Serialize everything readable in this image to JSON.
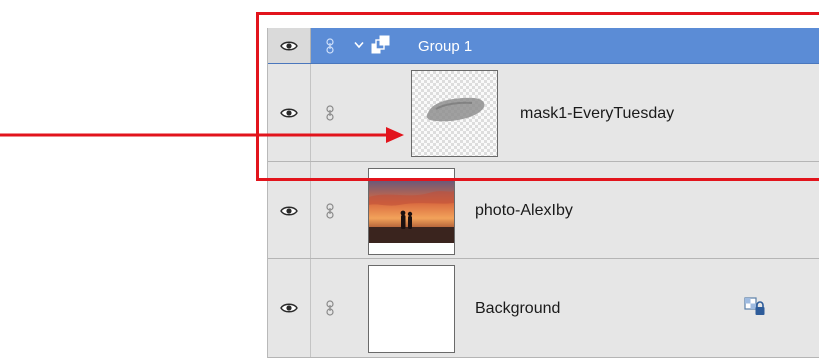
{
  "colors": {
    "group_row": "#5b8cd6",
    "annotation": "#e2141c",
    "panel_bg": "#e6e6e6"
  },
  "layers_panel": {
    "group": {
      "label": "Group 1",
      "expanded": true,
      "visible": true,
      "icons": [
        "eye-icon",
        "link-icon",
        "chevron-down-icon",
        "folder-group-icon"
      ]
    },
    "layers": [
      {
        "name": "mask1-EveryTuesday",
        "thumbnail": "mask-thumbnail",
        "visible": true
      },
      {
        "name": "photo-AlexIby",
        "thumbnail": "photo-thumbnail",
        "visible": true
      },
      {
        "name": "Background",
        "thumbnail": "white-thumbnail",
        "visible": true,
        "locked": true,
        "badge_icon": "lock-icon"
      }
    ]
  },
  "annotations": {
    "highlight": "red-highlight-box",
    "pointer": "red-arrow"
  }
}
